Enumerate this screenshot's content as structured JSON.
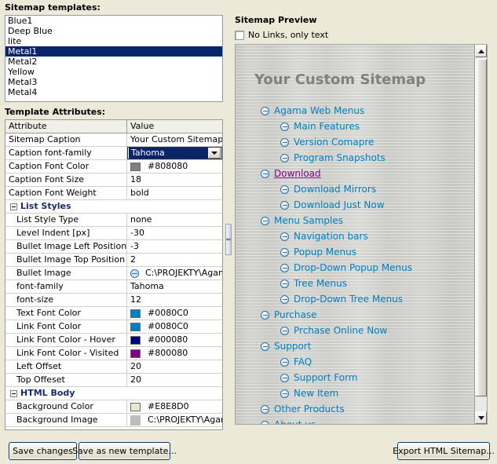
{
  "left": {
    "templates_label": "Sitemap templates:",
    "templates": [
      {
        "name": "Blue1",
        "selected": false
      },
      {
        "name": "Deep Blue",
        "selected": false
      },
      {
        "name": "lite",
        "selected": false
      },
      {
        "name": "Metal1",
        "selected": true
      },
      {
        "name": "Metal2",
        "selected": false
      },
      {
        "name": "Yellow",
        "selected": false
      },
      {
        "name": "Metal3",
        "selected": false
      },
      {
        "name": "Metal4",
        "selected": false
      }
    ],
    "attributes_label": "Template Attributes:",
    "grid": {
      "col_attribute": "Attribute",
      "col_value": "Value",
      "rows": [
        {
          "kind": "prop",
          "name": "Sitemap Caption",
          "value": "Your Custom Sitemap"
        },
        {
          "kind": "combo",
          "name": "Caption font-family",
          "value": "Tahoma"
        },
        {
          "kind": "color",
          "name": "Caption Font Color",
          "value": "#808080",
          "swatch": "#808080"
        },
        {
          "kind": "prop",
          "name": "Caption Font Size",
          "value": "18"
        },
        {
          "kind": "prop",
          "name": "Caption Font Weight",
          "value": "bold"
        },
        {
          "kind": "group",
          "name": "List Styles"
        },
        {
          "kind": "prop",
          "name": "List Style Type",
          "value": "none",
          "indent": true
        },
        {
          "kind": "prop",
          "name": "Level Indent [px]",
          "value": "-30",
          "indent": true
        },
        {
          "kind": "prop",
          "name": "Bullet Image Left Position [px]",
          "value": "-3",
          "indent": true
        },
        {
          "kind": "prop",
          "name": "Bullet Image Top Position [px]",
          "value": "2",
          "indent": true
        },
        {
          "kind": "bullet",
          "name": "Bullet Image",
          "value": "C:\\PROJEKTY\\AgamaWe",
          "indent": true
        },
        {
          "kind": "prop",
          "name": "font-family",
          "value": "Tahoma",
          "indent": true
        },
        {
          "kind": "prop",
          "name": "font-size",
          "value": "12",
          "indent": true
        },
        {
          "kind": "color",
          "name": "Text Font Color",
          "value": "#0080C0",
          "swatch": "#0080C0",
          "indent": true
        },
        {
          "kind": "color",
          "name": "Link Font Color",
          "value": "#0080C0",
          "swatch": "#0080C0",
          "indent": true
        },
        {
          "kind": "color",
          "name": "Link Font Color - Hover",
          "value": "#000080",
          "swatch": "#000080",
          "indent": true
        },
        {
          "kind": "color",
          "name": "Link Font Color - Visited",
          "value": "#800080",
          "swatch": "#800080",
          "indent": true
        },
        {
          "kind": "prop",
          "name": "Left Offset",
          "value": "20",
          "indent": true
        },
        {
          "kind": "prop",
          "name": "Top Offeset",
          "value": "20",
          "indent": true
        },
        {
          "kind": "group",
          "name": "HTML Body"
        },
        {
          "kind": "color",
          "name": "Background Color",
          "value": "#E8E8D0",
          "swatch": "#E8E8D0",
          "indent": true
        },
        {
          "kind": "image",
          "name": "Background Image",
          "value": "C:\\PROJEKTY\\AgamaWe",
          "indent": true
        }
      ]
    }
  },
  "right": {
    "preview_label": "Sitemap Preview",
    "no_links_label": "No Links, only text",
    "no_links_checked": false,
    "caption": "Your Custom Sitemap",
    "caption_color": "#808080",
    "link_color": "#0080C0",
    "visited_color": "#800080",
    "tree": [
      {
        "level": 0,
        "label": "Agama Web Menus",
        "state": "link"
      },
      {
        "level": 1,
        "label": "Main Features",
        "state": "link"
      },
      {
        "level": 1,
        "label": "Version Comapre",
        "state": "link"
      },
      {
        "level": 1,
        "label": "Program Snapshots",
        "state": "link"
      },
      {
        "level": 0,
        "label": "Download",
        "state": "visited"
      },
      {
        "level": 1,
        "label": "Download Mirrors",
        "state": "link"
      },
      {
        "level": 1,
        "label": "Download Just Now",
        "state": "link"
      },
      {
        "level": 0,
        "label": "Menu Samples",
        "state": "link"
      },
      {
        "level": 1,
        "label": "Navigation bars",
        "state": "link"
      },
      {
        "level": 1,
        "label": "Popup Menus",
        "state": "link"
      },
      {
        "level": 1,
        "label": "Drop-Down Popup Menus",
        "state": "link"
      },
      {
        "level": 1,
        "label": "Tree Menus",
        "state": "link"
      },
      {
        "level": 1,
        "label": "Drop-Down Tree Menus",
        "state": "link"
      },
      {
        "level": 0,
        "label": "Purchase",
        "state": "link"
      },
      {
        "level": 1,
        "label": "Prchase Online Now",
        "state": "link"
      },
      {
        "level": 0,
        "label": "Support",
        "state": "link"
      },
      {
        "level": 1,
        "label": "FAQ",
        "state": "link"
      },
      {
        "level": 1,
        "label": "Support Form",
        "state": "link"
      },
      {
        "level": 1,
        "label": "New Item",
        "state": "link"
      },
      {
        "level": 0,
        "label": "Other Products",
        "state": "link"
      },
      {
        "level": 0,
        "label": "About us",
        "state": "link"
      }
    ]
  },
  "buttons": {
    "save": "Save changes",
    "save_as_new": "Save as new template...",
    "export": "Export HTML Sitemap..."
  }
}
